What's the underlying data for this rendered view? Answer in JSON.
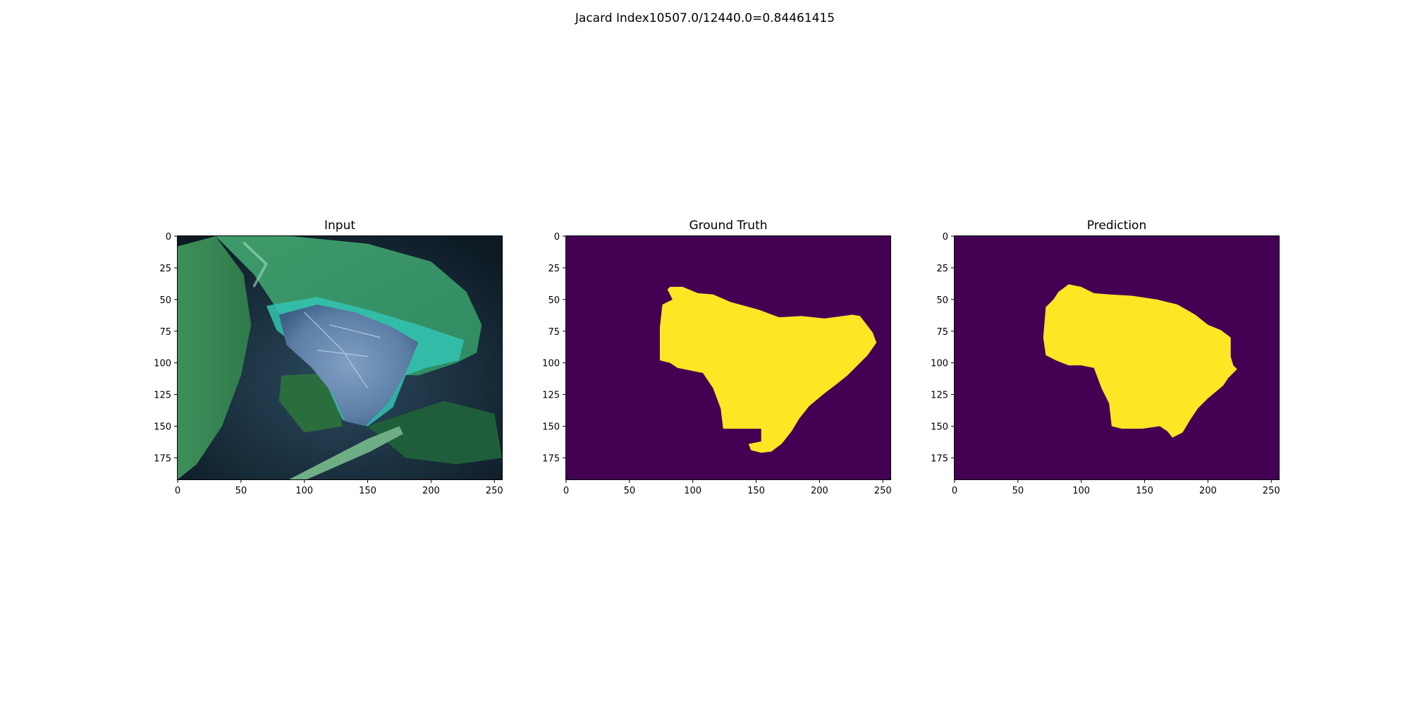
{
  "figure": {
    "suptitle": "Jacard Index10507.0/12440.0=0.84461415"
  },
  "colors": {
    "background": "#440154",
    "mask": "#fde725"
  },
  "chart_data": [
    {
      "type": "image",
      "title": "Input",
      "xlim": [
        0,
        256
      ],
      "ylim": [
        192,
        0
      ],
      "xticks": [
        "0",
        "50",
        "100",
        "150",
        "200",
        "250"
      ],
      "yticks": [
        "0",
        "25",
        "50",
        "75",
        "100",
        "125",
        "150",
        "175"
      ]
    },
    {
      "type": "image",
      "title": "Ground Truth",
      "xlim": [
        0,
        256
      ],
      "ylim": [
        192,
        0
      ],
      "xticks": [
        "0",
        "50",
        "100",
        "150",
        "200",
        "250"
      ],
      "yticks": [
        "0",
        "25",
        "50",
        "75",
        "100",
        "125",
        "150",
        "175"
      ],
      "mask_polygon": [
        [
          82,
          40
        ],
        [
          92,
          40
        ],
        [
          104,
          45
        ],
        [
          116,
          46
        ],
        [
          130,
          52
        ],
        [
          152,
          58
        ],
        [
          168,
          64
        ],
        [
          186,
          63
        ],
        [
          204,
          65
        ],
        [
          226,
          62
        ],
        [
          232,
          63
        ],
        [
          242,
          76
        ],
        [
          245,
          84
        ],
        [
          238,
          94
        ],
        [
          222,
          110
        ],
        [
          212,
          118
        ],
        [
          204,
          124
        ],
        [
          192,
          134
        ],
        [
          184,
          144
        ],
        [
          178,
          154
        ],
        [
          170,
          164
        ],
        [
          162,
          170
        ],
        [
          154,
          171
        ],
        [
          146,
          169
        ],
        [
          144,
          164
        ],
        [
          154,
          162
        ],
        [
          154,
          152
        ],
        [
          136,
          152
        ],
        [
          124,
          152
        ],
        [
          122,
          136
        ],
        [
          116,
          120
        ],
        [
          108,
          108
        ],
        [
          98,
          106
        ],
        [
          88,
          104
        ],
        [
          82,
          100
        ],
        [
          74,
          98
        ],
        [
          74,
          72
        ],
        [
          76,
          54
        ],
        [
          84,
          50
        ],
        [
          80,
          42
        ]
      ]
    },
    {
      "type": "image",
      "title": "Prediction",
      "xlim": [
        0,
        256
      ],
      "ylim": [
        192,
        0
      ],
      "xticks": [
        "0",
        "50",
        "100",
        "150",
        "200",
        "250"
      ],
      "yticks": [
        "0",
        "25",
        "50",
        "75",
        "100",
        "125",
        "150",
        "175"
      ],
      "mask_polygon": [
        [
          82,
          44
        ],
        [
          90,
          38
        ],
        [
          100,
          40
        ],
        [
          110,
          45
        ],
        [
          122,
          46
        ],
        [
          140,
          47
        ],
        [
          160,
          50
        ],
        [
          176,
          54
        ],
        [
          190,
          62
        ],
        [
          200,
          70
        ],
        [
          210,
          74
        ],
        [
          218,
          80
        ],
        [
          218,
          95
        ],
        [
          220,
          102
        ],
        [
          223,
          105
        ],
        [
          216,
          112
        ],
        [
          212,
          118
        ],
        [
          200,
          128
        ],
        [
          192,
          136
        ],
        [
          186,
          145
        ],
        [
          180,
          155
        ],
        [
          172,
          159
        ],
        [
          168,
          154
        ],
        [
          162,
          150
        ],
        [
          148,
          152
        ],
        [
          132,
          152
        ],
        [
          124,
          150
        ],
        [
          122,
          132
        ],
        [
          116,
          120
        ],
        [
          110,
          104
        ],
        [
          100,
          102
        ],
        [
          90,
          102
        ],
        [
          80,
          98
        ],
        [
          72,
          94
        ],
        [
          70,
          80
        ],
        [
          72,
          56
        ],
        [
          78,
          50
        ]
      ]
    }
  ]
}
